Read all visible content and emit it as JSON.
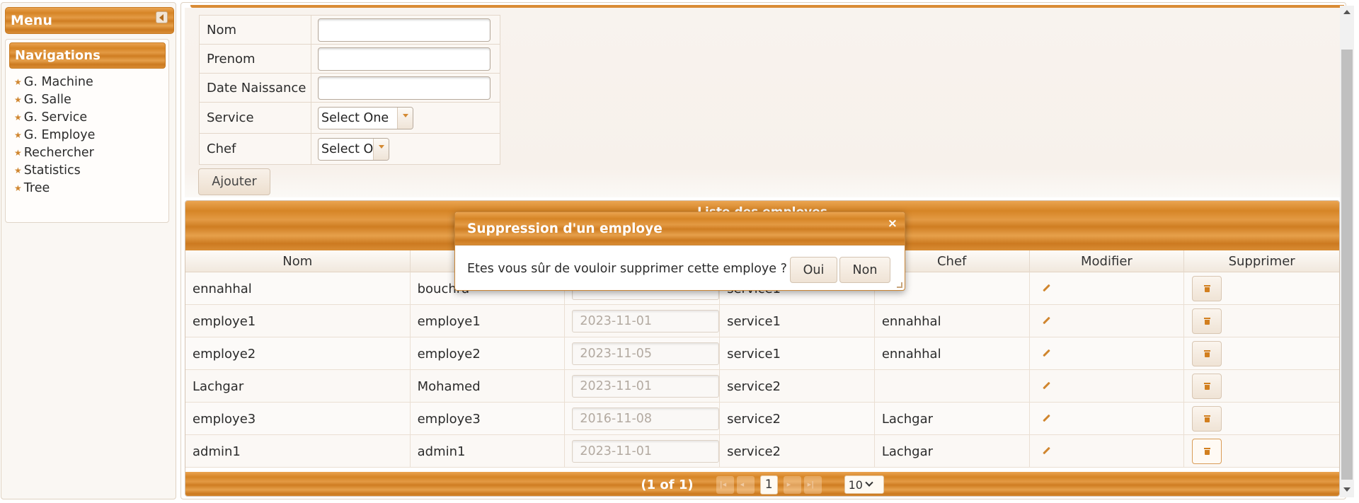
{
  "menu": {
    "title": "Menu",
    "navigation_title": "Navigations",
    "items": [
      {
        "label": "G. Machine"
      },
      {
        "label": "G. Salle"
      },
      {
        "label": "G. Service"
      },
      {
        "label": "G. Employe"
      },
      {
        "label": "Rechercher"
      },
      {
        "label": "Statistics"
      },
      {
        "label": "Tree"
      }
    ]
  },
  "form": {
    "fields": {
      "nom": {
        "label": "Nom",
        "value": ""
      },
      "prenom": {
        "label": "Prenom",
        "value": ""
      },
      "date_naissance": {
        "label": "Date Naissance",
        "value": ""
      },
      "service": {
        "label": "Service",
        "selected": "Select One"
      },
      "chef": {
        "label": "Chef",
        "selected": "Select One"
      }
    },
    "submit_label": "Ajouter"
  },
  "grid": {
    "caption": "Liste des employes",
    "columns": [
      "Nom",
      "",
      "",
      "",
      "Chef",
      "Modifier",
      "Supprimer"
    ],
    "rows": [
      {
        "nom": "ennahhal",
        "prenom": "bouchra",
        "date": "",
        "service": "service1",
        "chef": ""
      },
      {
        "nom": "employe1",
        "prenom": "employe1",
        "date": "2023-11-01",
        "service": "service1",
        "chef": "ennahhal"
      },
      {
        "nom": "employe2",
        "prenom": "employe2",
        "date": "2023-11-05",
        "service": "service1",
        "chef": "ennahhal"
      },
      {
        "nom": "Lachgar",
        "prenom": "Mohamed",
        "date": "2023-11-01",
        "service": "service2",
        "chef": ""
      },
      {
        "nom": "employe3",
        "prenom": "employe3",
        "date": "2016-11-08",
        "service": "service2",
        "chef": "Lachgar"
      },
      {
        "nom": "admin1",
        "prenom": "admin1",
        "date": "2023-11-01",
        "service": "service2",
        "chef": "Lachgar"
      }
    ],
    "paginator": {
      "info": "(1 of 1)",
      "current_page": "1",
      "rows_per_page": "10"
    }
  },
  "dialog": {
    "title": "Suppression d'un employe",
    "close_glyph": "×",
    "message": "Etes vous sûr de vouloir supprimer cette employe ?",
    "confirm_label": "Oui",
    "cancel_label": "Non"
  },
  "colors": {
    "accent": "#d68526",
    "accent_light": "#eaa451"
  }
}
